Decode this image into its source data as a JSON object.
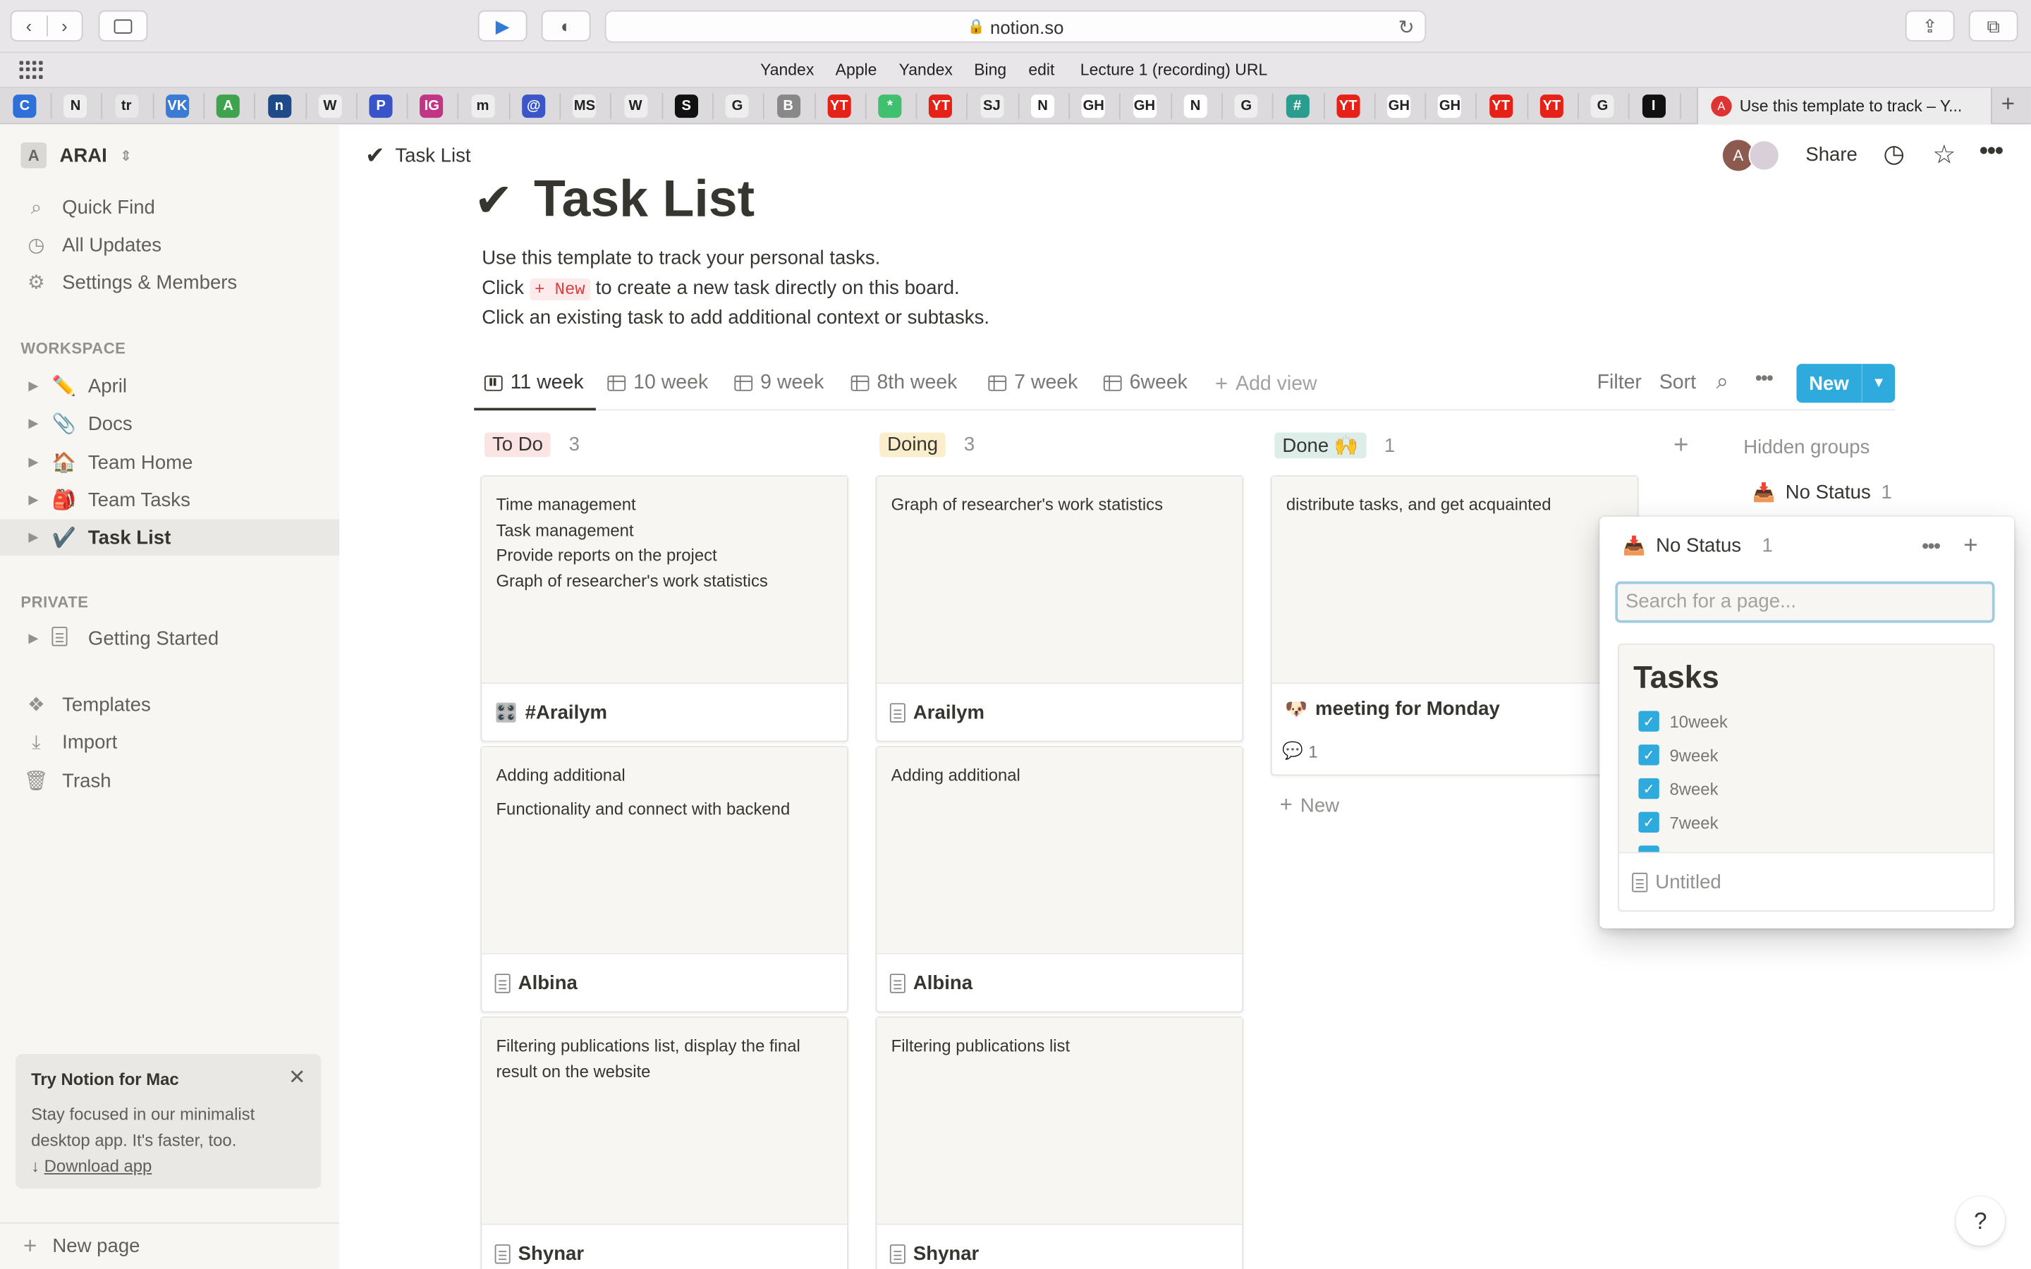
{
  "browser": {
    "url": "notion.so",
    "bookmarks": [
      "Yandex",
      "Apple",
      "Yandex",
      "Bing",
      "edit",
      "Lecture 1 (recording) URL"
    ],
    "active_tab_title": "Use this template to track – Y...",
    "tab_icons": [
      "C",
      "N",
      "tr",
      "VK",
      "A",
      "n",
      "W",
      "P",
      "IG",
      "m",
      "@",
      "MS",
      "W",
      "S",
      "G",
      "B",
      "YT",
      "*",
      "YT",
      "SJ",
      "N",
      "GH",
      "GH",
      "N",
      "G",
      "#",
      "YT",
      "GH",
      "GH",
      "YT",
      "YT",
      "G",
      "I"
    ]
  },
  "sidebar": {
    "workspace_initial": "A",
    "workspace_name": "ARAI",
    "top_items": [
      {
        "label": "Quick Find",
        "icon": "search-icon"
      },
      {
        "label": "All Updates",
        "icon": "clock-icon"
      },
      {
        "label": "Settings & Members",
        "icon": "gear-icon"
      }
    ],
    "workspace_header": "WORKSPACE",
    "workspace_items": [
      {
        "emoji": "✏️",
        "label": "April"
      },
      {
        "emoji": "📎",
        "label": "Docs"
      },
      {
        "emoji": "🏠",
        "label": "Team Home"
      },
      {
        "emoji": "🎒",
        "label": "Team Tasks"
      },
      {
        "emoji": "✔️",
        "label": "Task List"
      }
    ],
    "private_header": "PRIVATE",
    "private_items": [
      {
        "label": "Getting Started"
      }
    ],
    "bottom_items": [
      {
        "label": "Templates",
        "icon": "templates-icon"
      },
      {
        "label": "Import",
        "icon": "import-icon"
      },
      {
        "label": "Trash",
        "icon": "trash-icon"
      }
    ],
    "promo": {
      "title": "Try Notion for Mac",
      "body": "Stay focused in our minimalist desktop app. It's faster, too.",
      "link": "Download app"
    },
    "new_page": "New page"
  },
  "topbar": {
    "breadcrumb": "Task List",
    "share": "Share",
    "avatar_initial": "A"
  },
  "page": {
    "title": "Task List",
    "desc_line1": "Use this template to track your personal tasks.",
    "desc_line2_a": "Click",
    "desc_line2_tag": "+ New",
    "desc_line2_b": "to create a new task directly on this board.",
    "desc_line3": "Click an existing task to add additional context or subtasks."
  },
  "views": {
    "tabs": [
      "11 week",
      "10 week",
      "9 week",
      "8th week",
      "7 week",
      "6week"
    ],
    "add_view": "Add view",
    "filter": "Filter",
    "sort": "Sort",
    "new": "New"
  },
  "board": {
    "columns": [
      {
        "label": "To Do",
        "count": "3",
        "bg": "#fbe4e4",
        "fg": "#6b2a2a"
      },
      {
        "label": "Doing",
        "count": "3",
        "bg": "#fbeecc",
        "fg": "#5b4316"
      },
      {
        "label": "Done 🙌",
        "count": "1",
        "bg": "#ddedea",
        "fg": "#1f4a3a"
      }
    ],
    "todo": [
      {
        "lines": [
          "Time management",
          "Task management",
          "Provide reports on the project",
          "Graph of researcher's work statistics"
        ],
        "title": "#Arailym",
        "icon": "🎛️"
      },
      {
        "lines": [
          "Adding additional",
          "Functionality and connect with backend"
        ],
        "title": "Albina",
        "icon": "doc"
      },
      {
        "lines": [
          "Filtering publications list, display the final result on the website"
        ],
        "title": "Shynar",
        "icon": "doc"
      }
    ],
    "doing": [
      {
        "lines": [
          "Graph of researcher's work statistics"
        ],
        "title": "Arailym",
        "icon": "doc"
      },
      {
        "lines": [
          "Adding additional"
        ],
        "title": "Albina",
        "icon": "doc"
      },
      {
        "lines": [
          "Filtering publications list"
        ],
        "title": "Shynar",
        "icon": "doc"
      }
    ],
    "done": [
      {
        "lines": [
          "distribute tasks, and get acquainted"
        ],
        "title": "meeting for Monday",
        "icon": "🐶",
        "comments": "1"
      }
    ],
    "add_new": "New",
    "hidden_groups": "Hidden groups",
    "no_status": "No Status",
    "no_status_count": "1"
  },
  "popup": {
    "title": "No Status",
    "count": "1",
    "search_placeholder": "Search for a page...",
    "card_title": "Tasks",
    "checklist": [
      "10week",
      "9week",
      "8week",
      "7week"
    ],
    "footer": "Untitled"
  },
  "help": "?"
}
